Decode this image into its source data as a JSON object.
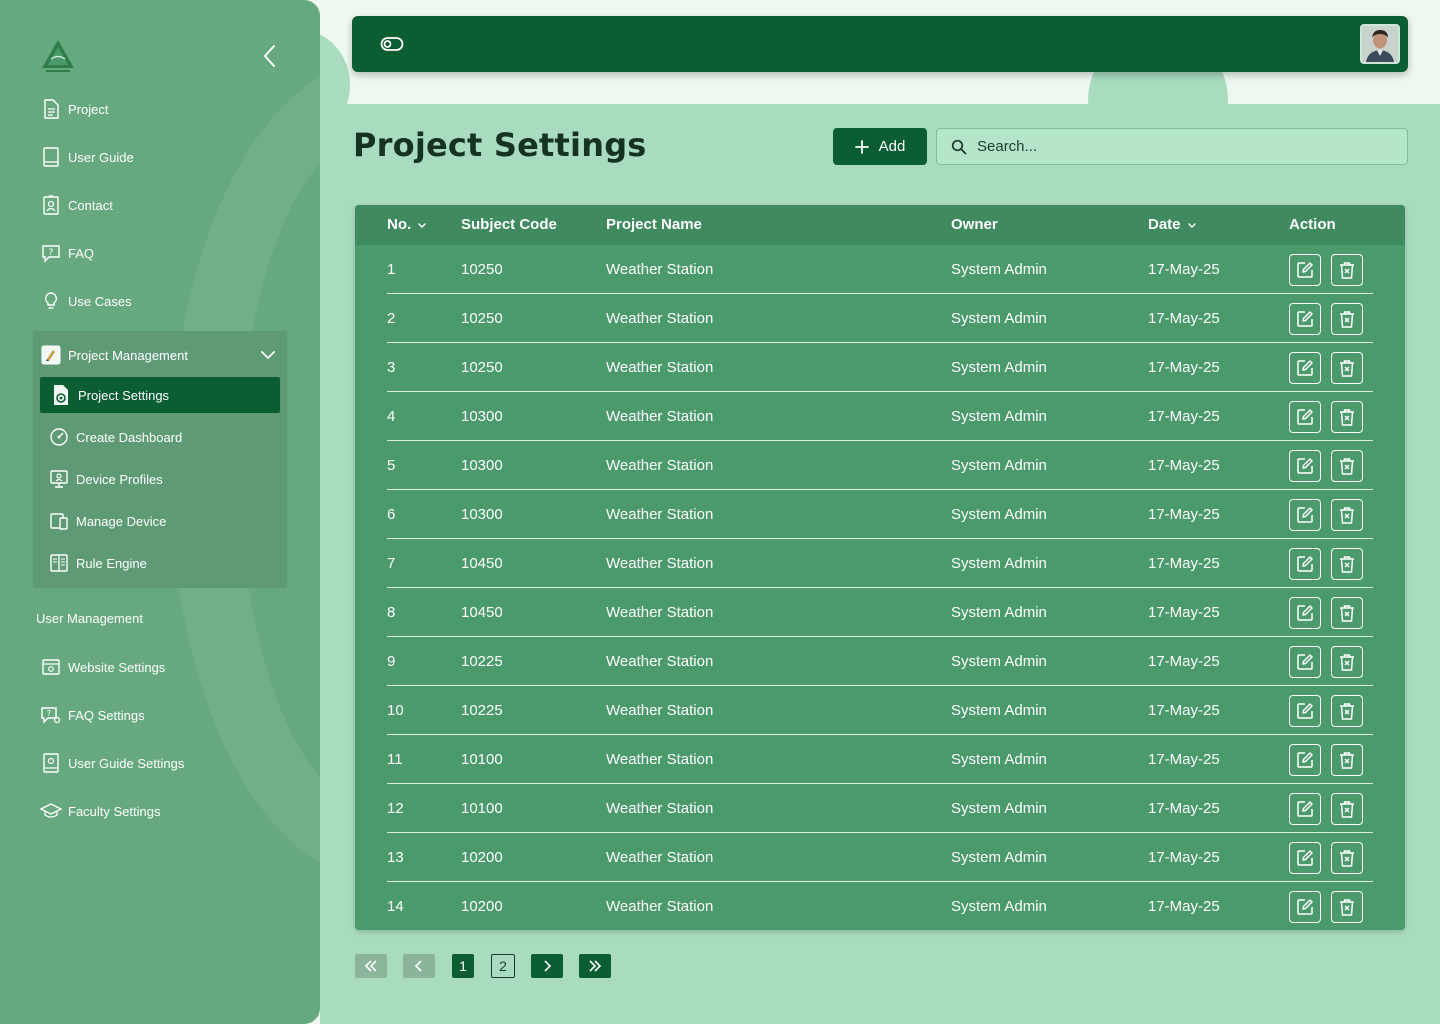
{
  "header": {
    "toggle_icon": "toggle-icon",
    "avatar": "user-avatar"
  },
  "sidebar": {
    "items": [
      {
        "label": "Project",
        "icon": "document-icon"
      },
      {
        "label": "User Guide",
        "icon": "book-icon"
      },
      {
        "label": "Contact",
        "icon": "contact-icon"
      },
      {
        "label": "FAQ",
        "icon": "question-chat-icon"
      },
      {
        "label": "Use Cases",
        "icon": "lightbulb-icon"
      }
    ],
    "group": {
      "label": "Project Management",
      "expanded": true,
      "items": [
        {
          "label": "Project Settings",
          "icon": "file-gear-icon",
          "active": true
        },
        {
          "label": "Create Dashboard",
          "icon": "gauge-icon"
        },
        {
          "label": "Device Profiles",
          "icon": "monitor-user-icon"
        },
        {
          "label": "Manage Device",
          "icon": "devices-icon"
        },
        {
          "label": "Rule Engine",
          "icon": "rules-book-icon"
        }
      ]
    },
    "section_label": "User Management",
    "user_items": [
      {
        "label": "Website Settings",
        "icon": "browser-gear-icon"
      },
      {
        "label": "FAQ Settings",
        "icon": "faq-gear-icon"
      },
      {
        "label": "User Guide Settings",
        "icon": "guide-gear-icon"
      },
      {
        "label": "Faculty Settings",
        "icon": "graduation-cap-icon"
      }
    ]
  },
  "page": {
    "title": "Project Settings",
    "add_label": "Add",
    "search_placeholder": "Search..."
  },
  "table": {
    "columns": [
      "No.",
      "Subject Code",
      "Project Name",
      "Owner",
      "Date",
      "Action"
    ],
    "rows": [
      [
        "1",
        "10250",
        "Weather Station",
        "System Admin",
        "17-May-25"
      ],
      [
        "2",
        "10250",
        "Weather Station",
        "System Admin",
        "17-May-25"
      ],
      [
        "3",
        "10250",
        "Weather Station",
        "System Admin",
        "17-May-25"
      ],
      [
        "4",
        "10300",
        "Weather Station",
        "System Admin",
        "17-May-25"
      ],
      [
        "5",
        "10300",
        "Weather Station",
        "System Admin",
        "17-May-25"
      ],
      [
        "6",
        "10300",
        "Weather Station",
        "System Admin",
        "17-May-25"
      ],
      [
        "7",
        "10450",
        "Weather Station",
        "System Admin",
        "17-May-25"
      ],
      [
        "8",
        "10450",
        "Weather Station",
        "System Admin",
        "17-May-25"
      ],
      [
        "9",
        "10225",
        "Weather Station",
        "System Admin",
        "17-May-25"
      ],
      [
        "10",
        "10225",
        "Weather Station",
        "System Admin",
        "17-May-25"
      ],
      [
        "11",
        "10100",
        "Weather Station",
        "System Admin",
        "17-May-25"
      ],
      [
        "12",
        "10100",
        "Weather Station",
        "System Admin",
        "17-May-25"
      ],
      [
        "13",
        "10200",
        "Weather Station",
        "System Admin",
        "17-May-25"
      ],
      [
        "14",
        "10200",
        "Weather Station",
        "System Admin",
        "17-May-25"
      ]
    ]
  },
  "pagination": {
    "pages": [
      "1",
      "2"
    ],
    "current": "1"
  },
  "colors": {
    "primary": "#0b5e32",
    "sidebar": "#67a97f",
    "panel": "#a9dcbe",
    "table": "#4a9a6b"
  }
}
